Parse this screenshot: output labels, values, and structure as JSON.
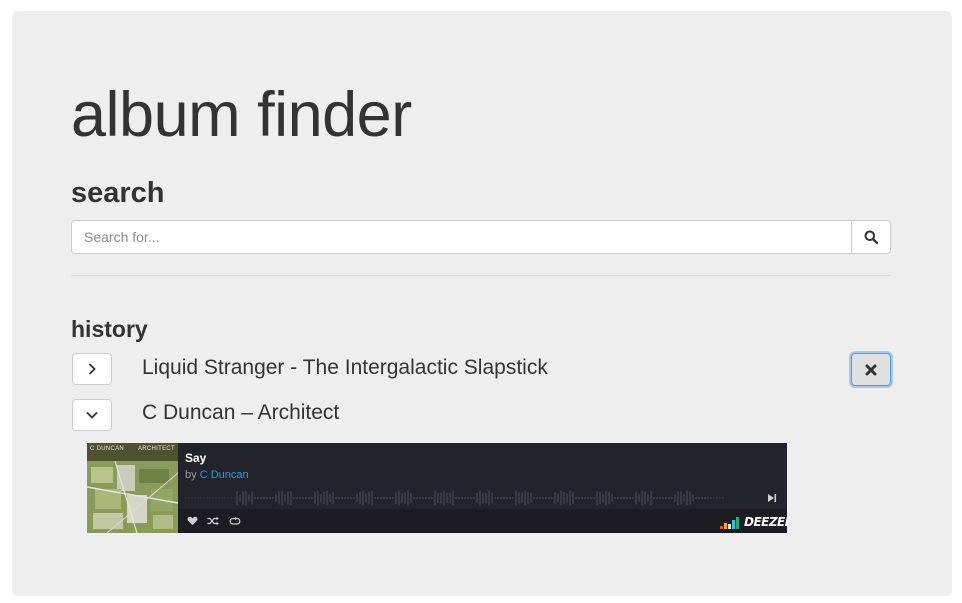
{
  "app": {
    "title": "album finder"
  },
  "search": {
    "heading": "search",
    "placeholder": "Search for...",
    "button_icon": "search-icon"
  },
  "history": {
    "heading": "history",
    "items": [
      {
        "label": "Liquid Stranger - The Intergalactic Slapstick",
        "toggle_icon": "chevron-right-icon",
        "expanded": false,
        "remove_icon": "times-icon"
      },
      {
        "label": "C Duncan – Architect",
        "toggle_icon": "chevron-down-icon",
        "expanded": true
      }
    ]
  },
  "player": {
    "cover_left": "C DUNCAN",
    "cover_right": "ARCHITECT",
    "track_title": "Say",
    "by_label": "by",
    "artist": "C Duncan",
    "brand": "DEEZER",
    "icons": [
      "heart-icon",
      "shuffle-icon",
      "repeat-icon",
      "next-track-icon"
    ]
  },
  "colors": {
    "jumbotron_bg": "#eeeeee",
    "player_bg": "#23232b",
    "link": "#2d9cdb",
    "focus_ring": "#66afe9"
  }
}
